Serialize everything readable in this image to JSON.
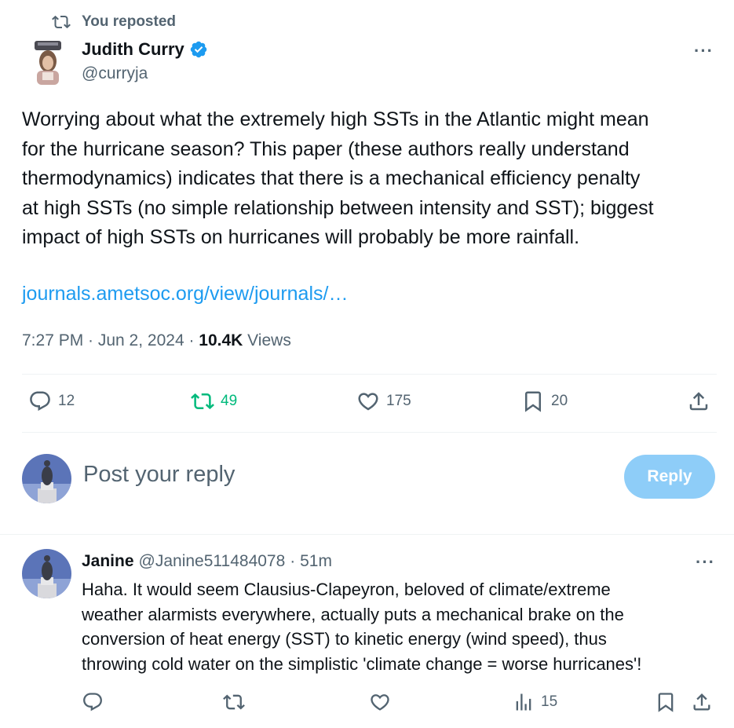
{
  "repost_banner": {
    "label": "You reposted",
    "icon": "repost-icon"
  },
  "author": {
    "name": "Judith Curry",
    "handle": "@curryja",
    "verified_icon": "verified-badge-icon",
    "verified_color": "#1d9bf0"
  },
  "more_menu": "···",
  "tweet": {
    "text": "Worrying about what the extremely high SSTs in the Atlantic might mean\nfor the hurricane season?  This paper (these authors really understand\nthermodynamics) indicates that there is a mechanical efficiency penalty\nat high SSTs (no simple relationship between intensity and SST); biggest\nimpact of high SSTs on hurricanes will probably be more rainfall.",
    "link": "journals.ametsoc.org/view/journals/…",
    "timestamp": "7:27 PM · Jun 2, 2024 · ",
    "views_count": "10.4K",
    "views_label": " Views"
  },
  "actions": {
    "replies": "12",
    "reposts": "49",
    "likes": "175",
    "bookmarks": "20",
    "repost_color": "#00ba7c",
    "icons": [
      "reply-icon",
      "repost-icon",
      "like-icon",
      "bookmark-icon",
      "share-icon"
    ]
  },
  "composer": {
    "placeholder": "Post your reply",
    "button_label": "Reply",
    "button_color": "#8ecdf8"
  },
  "reply": {
    "name": "Janine",
    "handle": "@Janine511484078",
    "time": "· 51m",
    "text": "Haha. It would seem Clausius-Clapeyron, beloved of climate/extreme\nweather alarmists everywhere, actually puts a mechanical brake on the\nconversion of heat energy (SST) to kinetic energy (wind speed), thus\nthrowing cold water on the simplistic 'climate change = worse hurricanes'!",
    "views": "15"
  },
  "colors": {
    "text": "#0f1419",
    "secondary": "#536471",
    "link": "#1d9bf0",
    "divider": "#eff3f4"
  }
}
